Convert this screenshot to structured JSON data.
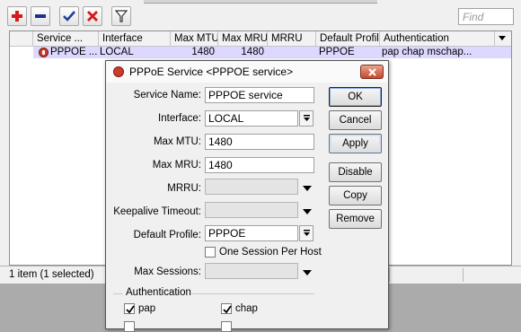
{
  "toolbar": {
    "find_placeholder": "Find"
  },
  "table": {
    "columns": [
      "Service ...",
      "Interface",
      "Max MTU",
      "Max MRU",
      "MRRU",
      "Default Profile",
      "Authentication"
    ],
    "row": {
      "service": "PPPOE ...",
      "interface": "LOCAL",
      "max_mtu": "1480",
      "max_mru": "1480",
      "mrru": "",
      "default_profile": "PPPOE",
      "authentication": "pap chap mschap..."
    }
  },
  "status": {
    "text": "1 item (1 selected)"
  },
  "dialog": {
    "title": "PPPoE Service <PPPOE service>",
    "labels": {
      "service_name": "Service Name:",
      "interface": "Interface:",
      "max_mtu": "Max MTU:",
      "max_mru": "Max MRU:",
      "mrru": "MRRU:",
      "keepalive_timeout": "Keepalive Timeout:",
      "default_profile": "Default Profile:",
      "max_sessions": "Max Sessions:"
    },
    "values": {
      "service_name": "PPPOE service",
      "interface": "LOCAL",
      "max_mtu": "1480",
      "max_mru": "1480",
      "mrru": "",
      "keepalive_timeout": "",
      "default_profile": "PPPOE",
      "max_sessions": ""
    },
    "one_session_label": "One Session Per Host",
    "one_session_checked": false,
    "auth_group_label": "Authentication",
    "auth": {
      "pap": "pap",
      "chap": "chap",
      "pap_checked": true,
      "chap_checked": true
    },
    "buttons": {
      "ok": "OK",
      "cancel": "Cancel",
      "apply": "Apply",
      "disable": "Disable",
      "copy": "Copy",
      "remove": "Remove"
    }
  },
  "colors": {
    "selected_row": "#ddd8ff",
    "add_icon": "#d41a1a",
    "remove_icon": "#1f2f8f",
    "check_icon": "#1f3fa0",
    "cross_icon": "#d41a1a"
  },
  "icons": [
    "add-icon",
    "remove-icon",
    "enable-check-icon",
    "disable-cross-icon",
    "filter-icon",
    "pppoe-service-icon",
    "close-icon",
    "chevron-down-icon"
  ]
}
